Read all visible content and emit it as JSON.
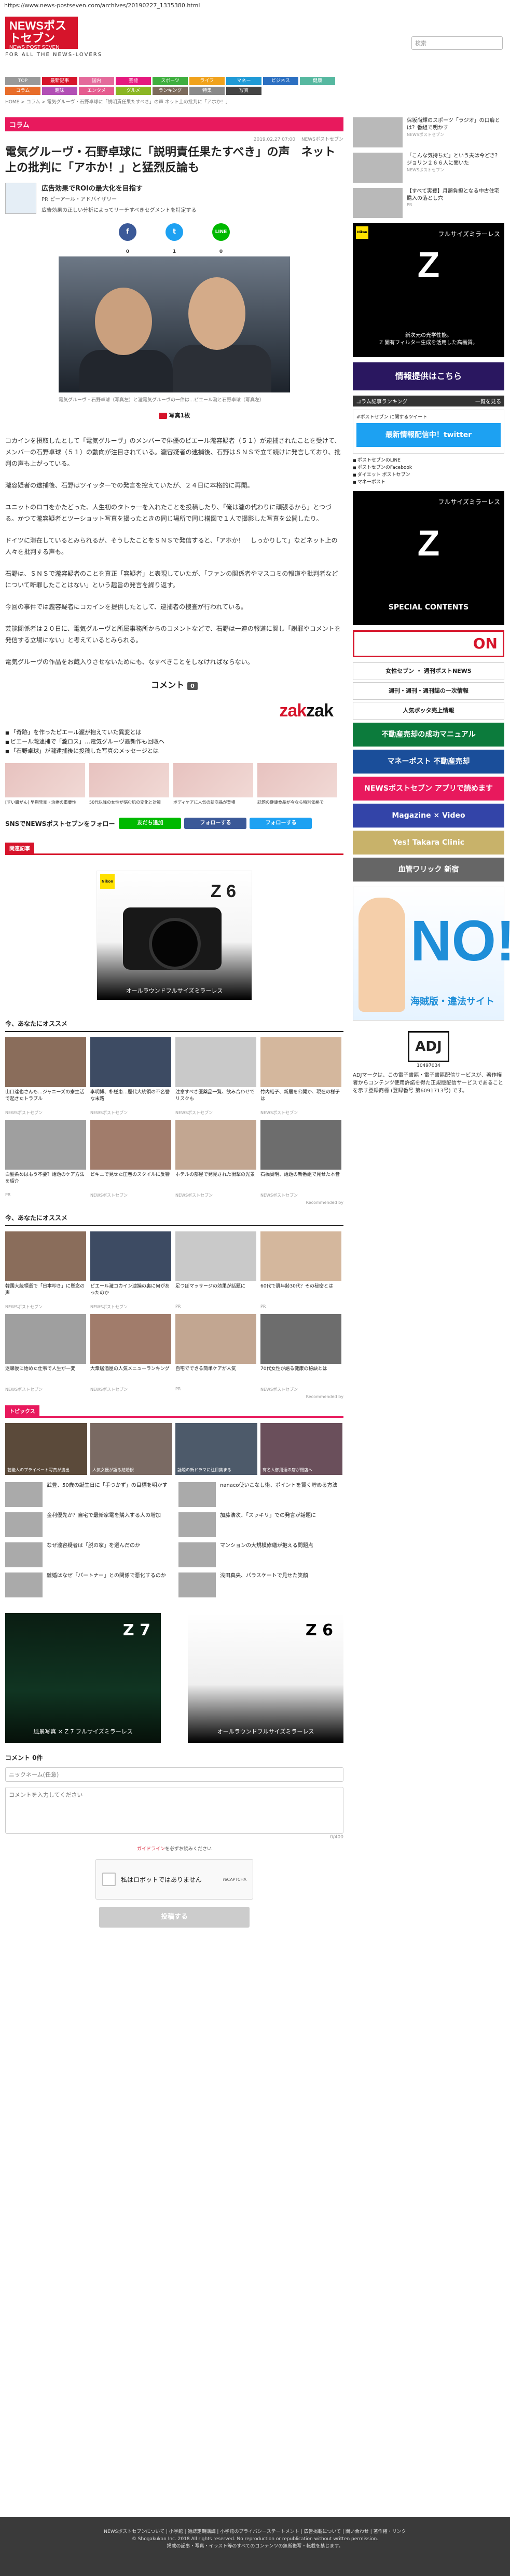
{
  "url": "https://www.news-postseven.com/archives/20190227_1335380.html",
  "header": {
    "logo_text": "NEWSポストセブン",
    "logo_sub": "NEWS POST SEVEN",
    "tagline": "FOR ALL THE NEWS-LOVERS",
    "search_placeholder": "検索"
  },
  "nav": [
    {
      "label": "TOP",
      "color": "#999999"
    },
    {
      "label": "最新記事",
      "color": "#d6142b"
    },
    {
      "label": "国内",
      "color": "#e46a9b"
    },
    {
      "label": "芸能",
      "color": "#e5197e"
    },
    {
      "label": "スポーツ",
      "color": "#3fae3f"
    },
    {
      "label": "ライフ",
      "color": "#f0a21c"
    },
    {
      "label": "マネー",
      "color": "#1f9ad6"
    },
    {
      "label": "ビジネス",
      "color": "#2b6fc1"
    },
    {
      "label": "健康",
      "color": "#56b8a0"
    },
    {
      "label": "コラム",
      "color": "#e86d2a"
    },
    {
      "label": "趣味",
      "color": "#b24fb5"
    },
    {
      "label": "エンタメ",
      "color": "#e55c8f"
    },
    {
      "label": "グルメ",
      "color": "#8bb624"
    },
    {
      "label": "ランキング",
      "color": "#7c6b5c"
    },
    {
      "label": "特集",
      "color": "#8a8a8a"
    },
    {
      "label": "写真",
      "color": "#444444"
    }
  ],
  "breadcrumb": "HOME > コラム > 電気グルーヴ・石野卓球に「説明責任果たすべき」の声 ネット上の批判に「アホか！」",
  "article": {
    "section": "コラム",
    "date": "2019.02.27 07:00　 NEWSポストセブン",
    "title": "電気グルーヴ・石野卓球に「説明責任果たすべき」の声　ネット上の批判に「アホか！」と猛烈反論も",
    "author_name": "広告効果でROIの最大化を目指す",
    "author_org": "PR ピーアール・アドバイザリー",
    "author_desc": "広告効果の正しい分析によってリーチすべきセグメントを特定する",
    "photo_caption": "電気グルーヴ・石野卓球（写真左）と瀧電気グルーヴの一件は…ピエール瀧と石野卓球（写真左）",
    "photo_count": "写真1枚",
    "paragraphs": [
      "コカインを摂取したとして「電気グルーヴ」のメンバーで俳優のピエール瀧容疑者（５１）が逮捕されたことを受けて、メンバーの石野卓球（５１）の動向が注目されている。瀧容疑者の逮捕後、石野はＳＮＳで立て続けに発言しており、批判の声も上がっている。",
      "瀧容疑者の逮捕後、石野はツイッターでの発言を控えていたが、２４日に本格的に再開。",
      "ユニットのロゴをかたどった、人生初のタトゥーを入れたことを投稿したり、「俺は瀧の代わりに頑張るから」とつづる。かつて瀧容疑者とツーショット写真を撮ったときの同じ場所で同じ構図で１人で撮影した写真を公開したり。",
      "ドイツに滞在しているとみられるが、そうしたことをＳＮＳで発信すると、「アホか！　しっかりして」などネット上の人々を批判する声も。",
      "石野は、ＳＮＳで瀧容疑者のことを真正「容疑者」と表現していたが、「ファンの関係者やマスコミの報道や批判者などについて断罪したことはない」という趣旨の発言を繰り返す。",
      "今回の事件では瀧容疑者にコカインを提供したとして、逮捕者の捜査が行われている。",
      "芸能関係者は２０日に、電気グルーヴと所属事務所からのコメントなどで、石野は一連の報道に関し「謝罪やコメントを発信する立場にない」と考えているとみられる。",
      "電気グルーヴの作品をお蔵入りさせないためにも、なすべきことをしなければならない。"
    ]
  },
  "comment_header": {
    "label": "コメント",
    "count": "0"
  },
  "zakzak": {
    "prefix": "zak",
    "suffix": "zak"
  },
  "related": [
    "「奇跡」を作ったピエール瀧が抱えていた異変とは",
    "ピエール瀧逮捕で「瀧ロス」…電気グルーヴ最新作も回収へ",
    "「石野卓球」が瀧逮捕後に投稿した写真のメッセージとは"
  ],
  "thumbs": [
    "[すい臓がん] 早期発見・治療の重要性",
    "50代以降の女性が悩む肌の変化と対策",
    "ボディケアに人気の新商品が登場",
    "話題の健康食品が今なら特別価格で"
  ],
  "follow": {
    "label": "SNSでNEWSポストセブンをフォロー",
    "buttons": [
      {
        "label": "友だち追加",
        "color": "#00b900"
      },
      {
        "label": "フォローする",
        "color": "#3b5998"
      },
      {
        "label": "フォローする",
        "color": "#1da1f2"
      }
    ]
  },
  "pr_tab": "関連記事",
  "nikon_ad": {
    "brand": "Nikon",
    "model": "Z 6",
    "text": "オールラウンドフルサイズミラーレス"
  },
  "reco1": {
    "title": "今、あなたにオススメ",
    "items": [
      {
        "text": "山口達也さんも…ジャニーズの寮生活で起きたトラブル",
        "src": "NEWSポストセブン"
      },
      {
        "text": "李明博、朴槿恵…歴代大統領の不名誉な末路",
        "src": "NEWSポストセブン"
      },
      {
        "text": "注意すべき医薬品一覧、飲み合わせでリスクも",
        "src": "NEWSポストセブン"
      },
      {
        "text": "竹内結子、新居を公開か、現在の様子は",
        "src": "NEWSポストセブン"
      },
      {
        "text": "白髪染めはもう不要？話題のケア方法を紹介",
        "src": "PR"
      },
      {
        "text": "ビキニで見せた圧巻のスタイルに反響",
        "src": "NEWSポストセブン"
      },
      {
        "text": "ホテルの部屋で発見された衝撃の光景",
        "src": "NEWSポストセブン"
      },
      {
        "text": "石橋貴明、話題の新番組で見せた本音",
        "src": "NEWSポストセブン"
      }
    ],
    "foot": "Recommended by"
  },
  "reco2": {
    "title": "今、あなたにオススメ",
    "items": [
      {
        "text": "韓国大統領選で「日本叩き」に懸念の声",
        "src": "NEWSポストセブン"
      },
      {
        "text": "ピエール瀧コカイン逮捕の裏に何があったのか",
        "src": "NEWSポストセブン"
      },
      {
        "text": "足つぼマッサージの効果が話題に",
        "src": "PR"
      },
      {
        "text": "60代で肌年齢30代？その秘密とは",
        "src": "PR"
      },
      {
        "text": "退職後に始めた仕事で人生が一変",
        "src": "NEWSポストセブン"
      },
      {
        "text": "大衆居酒屋の人気メニューランキング",
        "src": "NEWSポストセブン"
      },
      {
        "text": "自宅でできる簡単ケアが人気",
        "src": "PR"
      },
      {
        "text": "70代女性が語る健康の秘訣とは",
        "src": "NEWSポストセブン"
      }
    ],
    "foot": "Recommended by"
  },
  "topics": {
    "tab": "トピックス",
    "cards": [
      "芸能人のプライベート写真が流出",
      "人気女優が語る結婚観",
      "話題の新ドラマに注目集まる",
      "有名人御用達の店が閉店へ"
    ],
    "list": [
      "武豊、50歳の誕生日に「手つかず」の目標を明かす",
      "nanaco使いこなし術、ポイントを賢く貯める方法",
      "金利優先か？自宅で最新家電を購入する人の増加",
      "加藤浩次、「スッキリ」での発言が話題に",
      "なぜ瀧容疑者は「脱の家」を選んだのか",
      "マンションの大規模修繕が抱える問題点",
      "離婚はなぜ「パートナー」との関係で悪化するのか",
      "浅田真央、パラスケートで見せた笑顔"
    ]
  },
  "bottom_ads": [
    {
      "text": "風景写真 × Z 7 フルサイズミラーレス",
      "model": "Z 7"
    },
    {
      "text": "オールラウンドフルサイズミラーレス",
      "model": "Z 6"
    }
  ],
  "comment_form": {
    "title": "コメント 0件",
    "name_placeholder": "ニックネーム(任意)",
    "body_placeholder": "コメントを入力してください",
    "counter": "0/400",
    "guide_prefix": "ガイドライン",
    "guide_suffix": "を必ずお読みください",
    "captcha_label": "私はロボットではありません",
    "captcha_brand": "reCAPTCHA",
    "submit": "投稿する"
  },
  "footer": {
    "links": "NEWSポストセブンについて | 小学館 | 雑誌定期購読 | 小学館のプライバシーステートメント | 広告掲載について | 問い合わせ | 著作権・リンク",
    "copyright": "© Shogakukan Inc. 2018 All rights reserved. No reproduction or republication without written permission.",
    "notice": "掲載の記事・写真・イラスト等のすべてのコンテンツの無断複写・転載を禁じます。"
  },
  "sidebar": {
    "top_items": [
      {
        "text": "保坂尚輝のスポーツ「ラジオ」の口癖とは？番組で明かす",
        "src": "NEWSポストセブン"
      },
      {
        "text": "「こんな気持ちだ」という夫は今どき？ジョリン２６６人に聞いた",
        "src": "NEWSポストセブン"
      },
      {
        "text": "【すべて実費】月額負担となる中古住宅購入の落とし穴",
        "src": "PR"
      }
    ],
    "nikon_z7": {
      "brand": "Nikon",
      "title": "フルサイズミラーレス",
      "model": "Z",
      "sub1": "新次元の光学性能。",
      "sub2": "Z 固有フィルター生成を活用した高画質。"
    },
    "purple": "情報提供はこちら",
    "ranking_label": "コラム記事ランキング",
    "ranking_more": "一覧を見る",
    "follow_label": "#ポストセブン に関するツイート",
    "twitter_banner": "最新情報配信中！twitter",
    "social": [
      "ポストセブンのLINE",
      "ポストセブンのFacebook",
      "ダイエット ポストセブン",
      "マネーポスト"
    ],
    "special": {
      "title": "フルサイズミラーレス",
      "model": "Z",
      "sub": "SPECIAL CONTENTS"
    },
    "on_banner": "ON",
    "small_banners": [
      "女性セブン ・ 週刊ポストNEWS",
      "週刊・週刊・週刊誌の一次情報",
      "人気ボッタ売上情報"
    ],
    "color_banners": [
      {
        "text": "不動産売却の成功マニュアル",
        "color": "#0c7b3c"
      },
      {
        "text": "マネーポスト 不動産売却",
        "color": "#1a4e9a"
      },
      {
        "text": "NEWSポストセブン アプリで読めます",
        "color": "#e8195d"
      },
      {
        "text": "Magazine × Video",
        "color": "#3344a8"
      },
      {
        "text": "Yes! Takara Clinic",
        "color": "#c8b26a"
      },
      {
        "text": "血管ワリック 新宿",
        "color": "#666666"
      }
    ],
    "blue_no": "NO!",
    "blue_no_text": "海賊版・違法サイト",
    "adj_mark": "ADJ",
    "adj_num": "10497034",
    "adj_text": "ADJマークは、この電子書籍・電子書籍配信サービスが、著作権者からコンテンツ使用許諾を得た正規版配信サービスであることを示す登録商標 (登録番号 第6091713号) です。"
  }
}
